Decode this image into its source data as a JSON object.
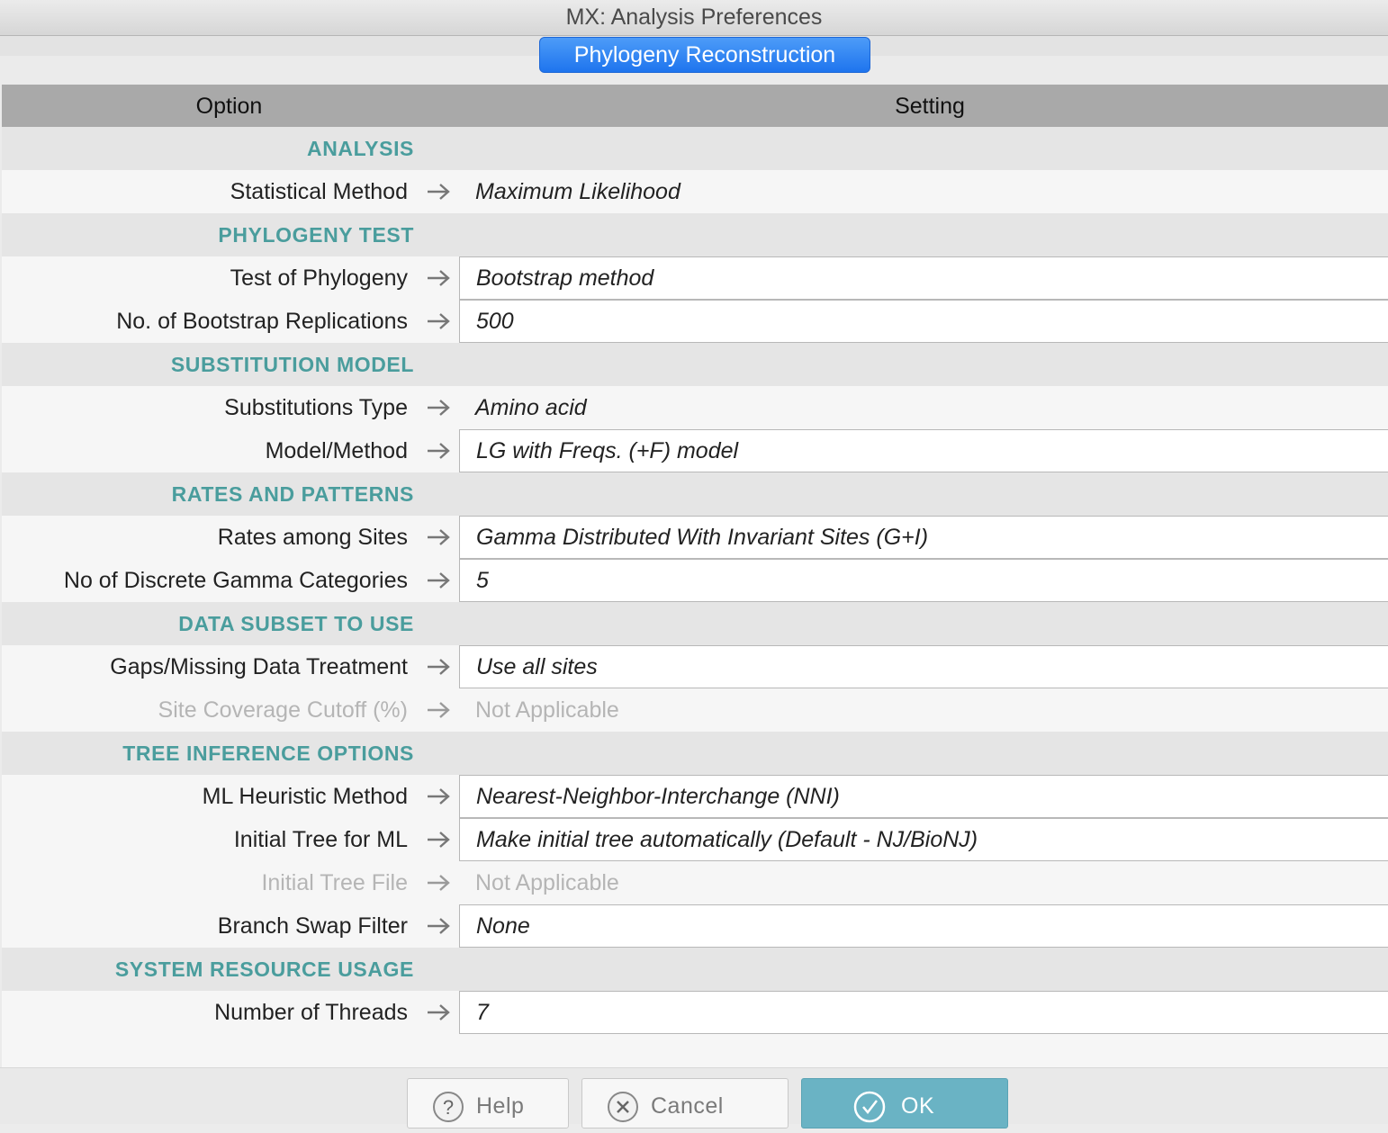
{
  "window": {
    "title": "MX: Analysis Preferences"
  },
  "tab": {
    "label": "Phylogeny Reconstruction"
  },
  "grid": {
    "header_option": "Option",
    "header_setting": "Setting",
    "rows": [
      {
        "type": "section",
        "label": "ANALYSIS"
      },
      {
        "type": "option",
        "label": "Statistical Method",
        "value": "Maximum Likelihood",
        "editable": false,
        "disabled": false
      },
      {
        "type": "section",
        "label": "PHYLOGENY TEST"
      },
      {
        "type": "option",
        "label": "Test of Phylogeny",
        "value": "Bootstrap method",
        "editable": true,
        "disabled": false
      },
      {
        "type": "option",
        "label": "No. of Bootstrap Replications",
        "value": "500",
        "editable": true,
        "disabled": false
      },
      {
        "type": "section",
        "label": "SUBSTITUTION MODEL"
      },
      {
        "type": "option",
        "label": "Substitutions Type",
        "value": "Amino acid",
        "editable": false,
        "disabled": false
      },
      {
        "type": "option",
        "label": "Model/Method",
        "value": "LG with Freqs. (+F) model",
        "editable": true,
        "disabled": false
      },
      {
        "type": "section",
        "label": "RATES AND PATTERNS"
      },
      {
        "type": "option",
        "label": "Rates among Sites",
        "value": "Gamma Distributed With Invariant Sites (G+I)",
        "editable": true,
        "disabled": false
      },
      {
        "type": "option",
        "label": "No of Discrete Gamma Categories",
        "value": "5",
        "editable": true,
        "disabled": false
      },
      {
        "type": "section",
        "label": "DATA SUBSET TO USE"
      },
      {
        "type": "option",
        "label": "Gaps/Missing Data Treatment",
        "value": "Use all sites",
        "editable": true,
        "disabled": false
      },
      {
        "type": "option",
        "label": "Site Coverage Cutoff (%)",
        "value": "Not Applicable",
        "editable": false,
        "disabled": true
      },
      {
        "type": "section",
        "label": "TREE INFERENCE OPTIONS"
      },
      {
        "type": "option",
        "label": "ML Heuristic Method",
        "value": "Nearest-Neighbor-Interchange (NNI)",
        "editable": true,
        "disabled": false
      },
      {
        "type": "option",
        "label": "Initial Tree for ML",
        "value": "Make initial tree automatically (Default - NJ/BioNJ)",
        "editable": true,
        "disabled": false
      },
      {
        "type": "option",
        "label": "Initial Tree File",
        "value": "Not Applicable",
        "editable": false,
        "disabled": true
      },
      {
        "type": "option",
        "label": "Branch Swap Filter",
        "value": "None",
        "editable": true,
        "disabled": false
      },
      {
        "type": "section",
        "label": "SYSTEM RESOURCE USAGE"
      },
      {
        "type": "option",
        "label": "Number of Threads",
        "value": "7",
        "editable": true,
        "disabled": false
      }
    ]
  },
  "buttons": {
    "help_label": "Help",
    "cancel_label": "Cancel",
    "ok_label": "OK"
  },
  "icons": {
    "arrow": "arrow-right-icon",
    "help": "question-circle-icon",
    "cancel": "x-circle-icon",
    "ok": "check-circle-icon"
  },
  "colors": {
    "section_text": "#4a9d9d",
    "tab_bg": "#2a7ff0",
    "ok_button": "#6ab3c4"
  }
}
